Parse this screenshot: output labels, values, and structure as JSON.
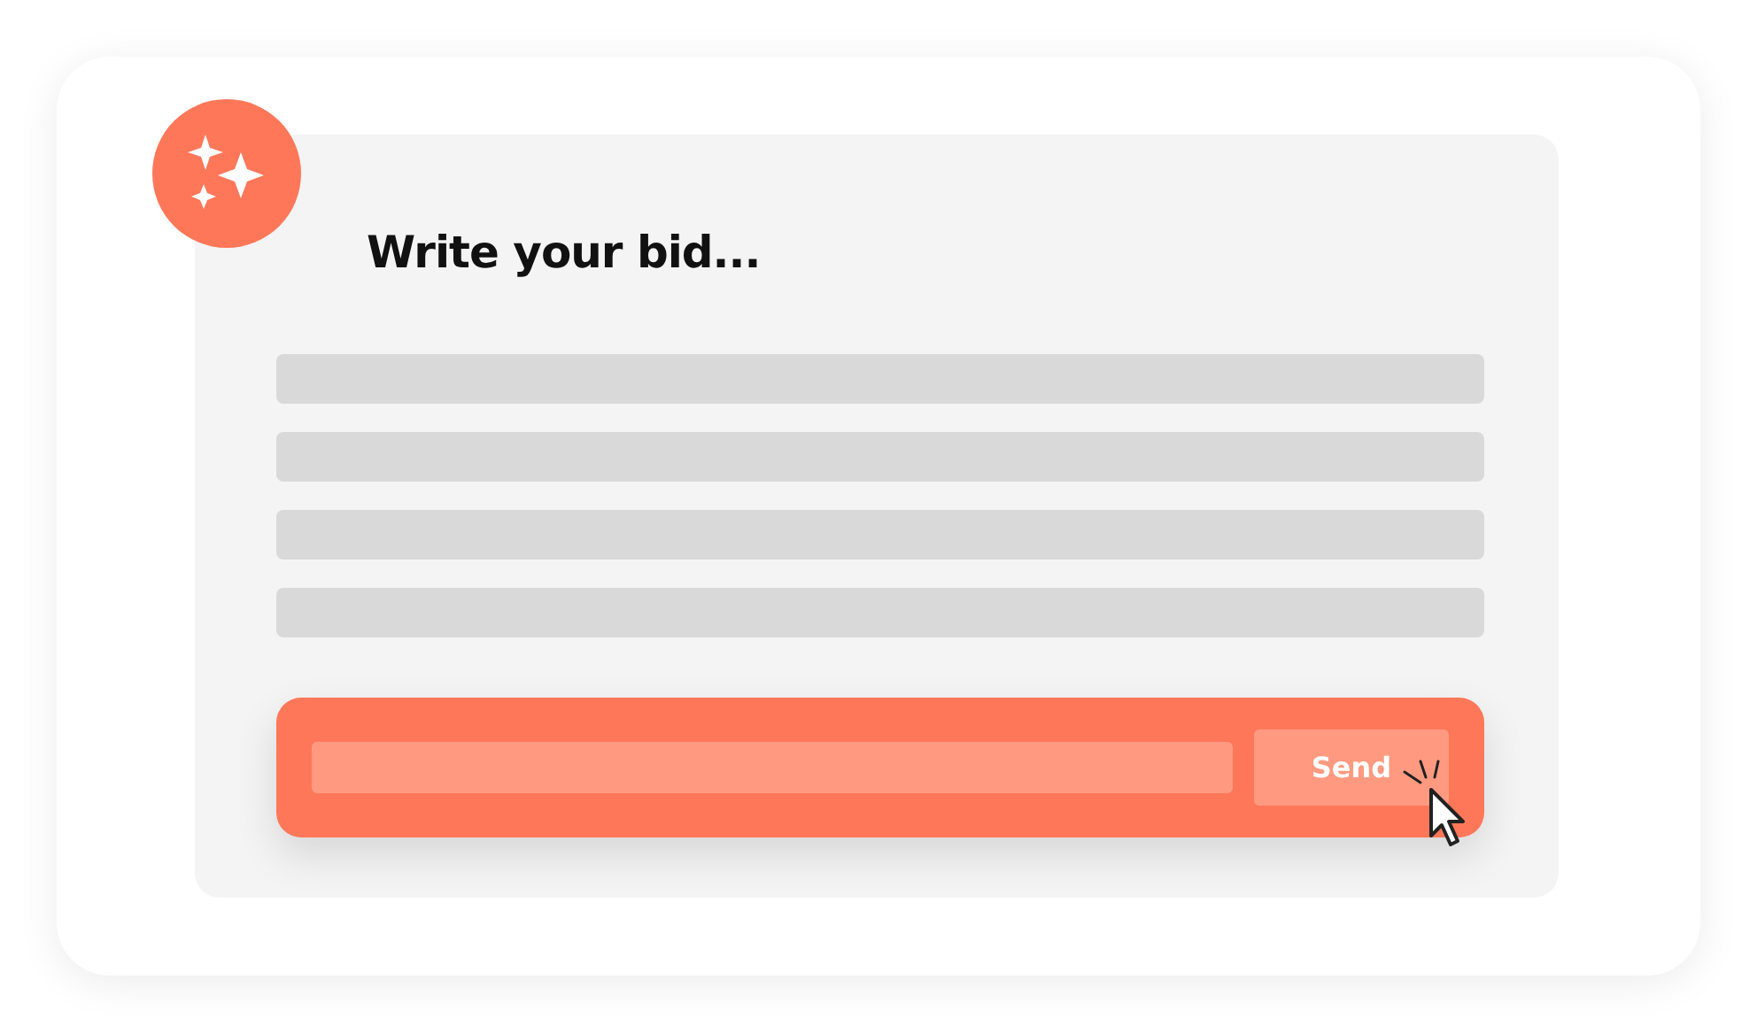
{
  "heading": "Write your bid...",
  "send_button": {
    "label": "Send"
  }
}
